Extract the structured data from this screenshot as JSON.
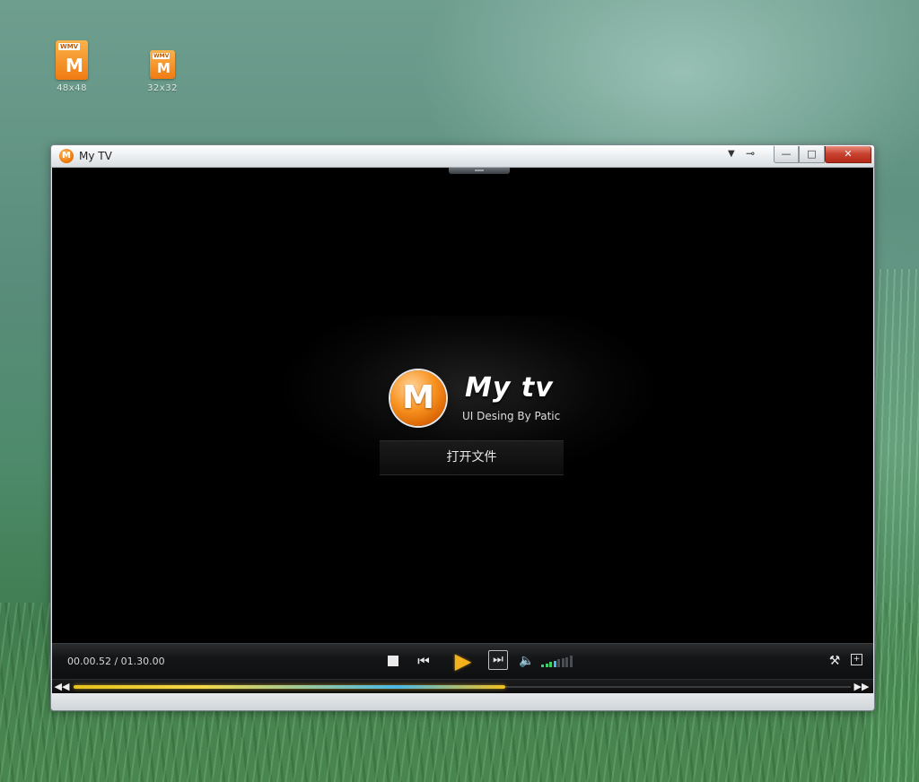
{
  "desktop": {
    "icons": [
      {
        "tag": "WMV",
        "caption": "48x48"
      },
      {
        "tag": "WMV",
        "caption": "32x32"
      }
    ]
  },
  "window": {
    "title": "My TV",
    "buttons": {
      "menu": "▼",
      "pin": "⊸",
      "minimize": "—",
      "maximize": "□",
      "close": "✕"
    }
  },
  "splash": {
    "logo_letter": "M",
    "brand_name": "My tv",
    "tagline": "UI Desing By Patic",
    "open_file_label": "打开文件"
  },
  "player": {
    "current_time": "00.00.52",
    "total_time": "01.30.00",
    "time_display": "00.00.52 / 01.30.00",
    "progress": 0.555,
    "volume_level": 0.5,
    "icons": {
      "stop": "stop-icon",
      "prev": "skip-back-icon",
      "play": "play-icon",
      "next": "skip-forward-icon",
      "volume": "speaker-icon",
      "tools": "hammer-icon",
      "fullscreen": "fullscreen-icon",
      "rewind": "rewind-icon",
      "forward": "fast-forward-icon"
    },
    "glyphs": {
      "prev": "⏮",
      "play": "▶",
      "next": "⏭",
      "volume": "🔈",
      "tools": "⚒",
      "fullscreen": "⛶",
      "rewind": "◀◀",
      "forward": "▶▶"
    }
  },
  "colors": {
    "accent": "#f3b21c",
    "progress_start": "#e6c21c",
    "progress_mid": "#4ab9e8",
    "close_button": "#c7402e"
  }
}
